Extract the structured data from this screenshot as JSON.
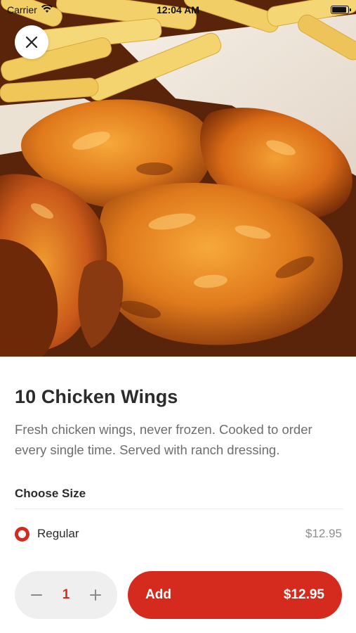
{
  "status_bar": {
    "carrier": "Carrier",
    "time": "12:04 AM"
  },
  "hero": {
    "image_subject": "chicken-wings-with-fries-photo"
  },
  "item": {
    "title": "10 Chicken Wings",
    "description": "Fresh chicken wings, never frozen. Cooked to order every single time. Served with ranch dressing."
  },
  "options_section": {
    "title": "Choose Size",
    "options": [
      {
        "label": "Regular",
        "price": "$12.95",
        "selected": true
      }
    ]
  },
  "cart": {
    "quantity": "1",
    "add_label": "Add",
    "add_price": "$12.95"
  },
  "icons": {
    "close": "close-icon",
    "wifi": "wifi-icon",
    "battery": "battery-icon",
    "minus": "minus-icon",
    "plus": "plus-icon",
    "radio": "radio-selected-icon"
  },
  "colors": {
    "accent": "#d52b1e",
    "stepper_bg": "#efefef",
    "title_text": "#2b2b2b",
    "description_text": "#6e6e6e",
    "price_text": "#8e8e8e"
  }
}
